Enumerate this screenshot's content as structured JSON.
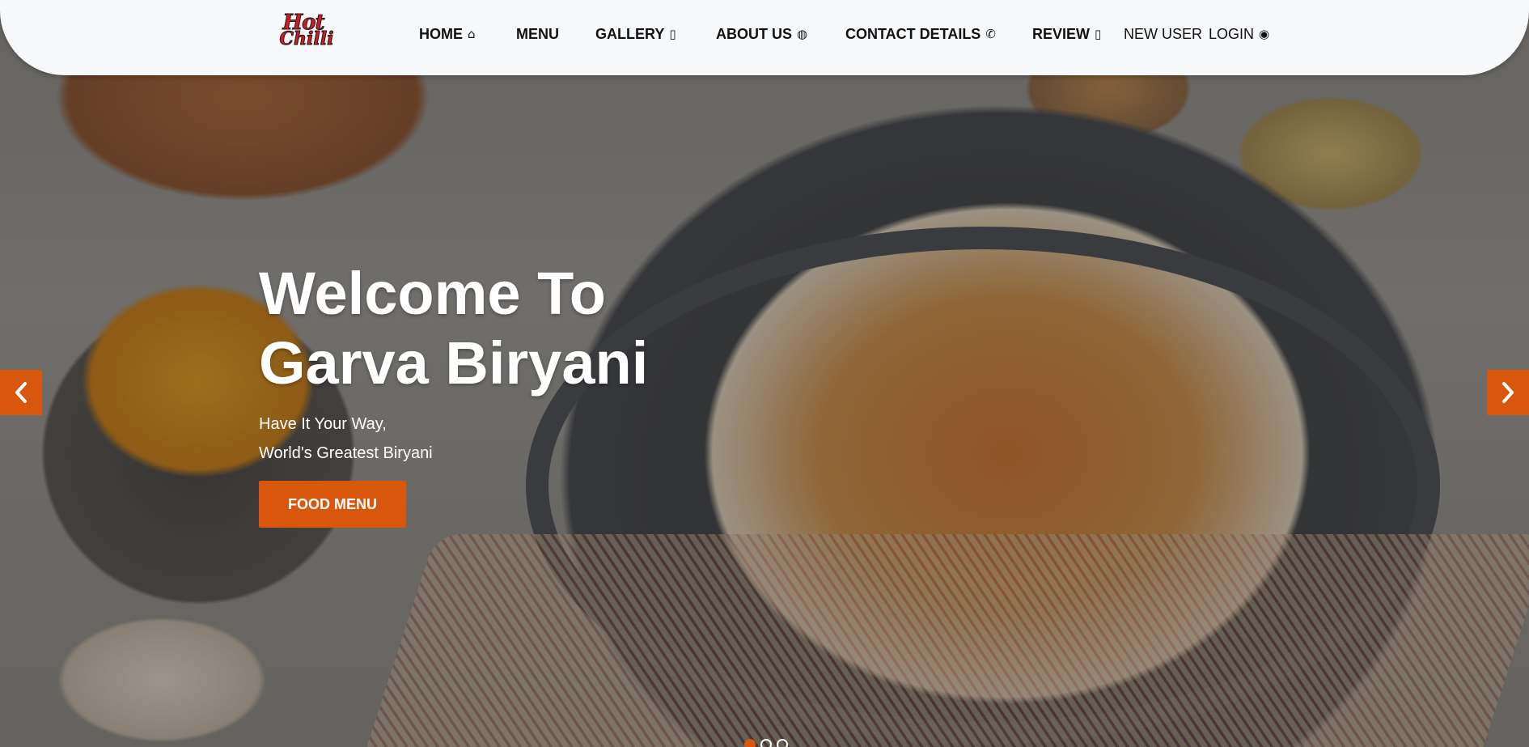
{
  "brand": {
    "logo_line1": "Hot",
    "logo_line2": "Chilli",
    "logo_color": "#d61820"
  },
  "nav": {
    "items": [
      {
        "label": "HOME",
        "icon": "home-icon"
      },
      {
        "label": "MENU",
        "icon": ""
      },
      {
        "label": "GALLERY",
        "icon": "gallery-icon"
      },
      {
        "label": "ABOUT US",
        "icon": "globe-icon"
      },
      {
        "label": "CONTACT DETAILS",
        "icon": "phone-icon"
      },
      {
        "label": "REVIEW",
        "icon": "review-icon"
      },
      {
        "label": "NEW USER",
        "icon": ""
      },
      {
        "label": "LOGIN",
        "icon": "user-circle-icon"
      }
    ]
  },
  "hero": {
    "title_line1": "Welcome To",
    "title_line2": "Garva Biryani",
    "subtitle_line1": "Have It Your Way,",
    "subtitle_line2": "World's Greatest Biryani",
    "button_label": "FOOD MENU"
  },
  "carousel": {
    "prev_icon": "chevron-left-icon",
    "next_icon": "chevron-right-icon",
    "slide_count": 3,
    "active_index": 0
  },
  "colors": {
    "accent": "#d9560d",
    "header_bg": "#f6f8fa"
  }
}
